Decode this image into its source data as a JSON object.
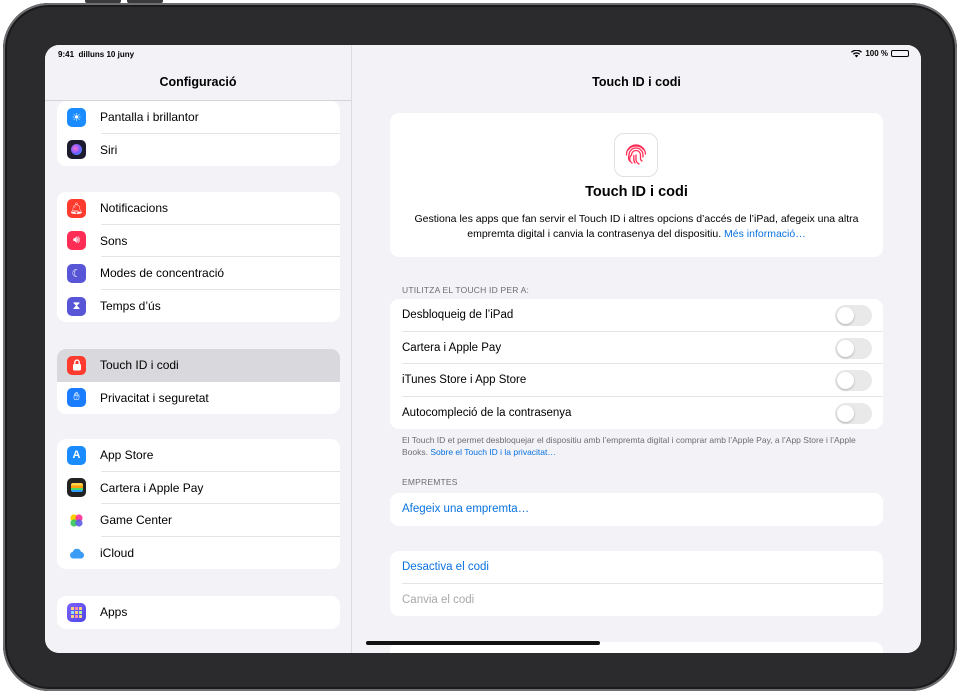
{
  "status_bar": {
    "time": "9:41",
    "date": "dilluns 10 juny",
    "battery": "100 %"
  },
  "sidebar": {
    "title": "Configuració",
    "groups": [
      {
        "items": [
          {
            "label": "Pantalla i brillantor",
            "icon": "sun-icon",
            "color": "#1a8cff"
          },
          {
            "label": "Siri",
            "icon": "siri-icon",
            "color": "#1c1c2e"
          }
        ]
      },
      {
        "items": [
          {
            "label": "Notificacions",
            "icon": "bell-icon",
            "color": "#ff3b30"
          },
          {
            "label": "Sons",
            "icon": "speaker-icon",
            "color": "#ff2d55"
          },
          {
            "label": "Modes de concentració",
            "icon": "moon-icon",
            "color": "#5856d6"
          },
          {
            "label": "Temps d’ús",
            "icon": "hourglass-icon",
            "color": "#5856d6"
          }
        ]
      },
      {
        "items": [
          {
            "label": "Touch ID i codi",
            "icon": "lock-icon",
            "color": "#ff3b30",
            "selected": true
          },
          {
            "label": "Privacitat i seguretat",
            "icon": "hand-icon",
            "color": "#1a7cff"
          }
        ]
      },
      {
        "items": [
          {
            "label": "App Store",
            "icon": "app-store-icon",
            "color": "#1a8cff"
          },
          {
            "label": "Cartera i Apple Pay",
            "icon": "wallet-icon",
            "color": "#222222"
          },
          {
            "label": "Game Center",
            "icon": "game-center-icon",
            "color": "#ffffff"
          },
          {
            "label": "iCloud",
            "icon": "cloud-icon",
            "color": "#ffffff"
          }
        ]
      },
      {
        "items": [
          {
            "label": "Apps",
            "icon": "apps-grid-icon",
            "color": "#5e5ce6"
          }
        ]
      }
    ]
  },
  "detail": {
    "title": "Touch ID i codi",
    "hero": {
      "title": "Touch ID i codi",
      "description": "Gestiona les apps que fan servir el Touch ID i altres opcions d’accés de l’iPad, afegeix una altra empremta digital i canvia la contrasenya del dispositiu.",
      "link": "Més informació…"
    },
    "use_section": {
      "header": "UTILITZA EL TOUCH ID PER A:",
      "toggles": [
        {
          "label": "Desbloqueig de l’iPad",
          "on": false
        },
        {
          "label": "Cartera i Apple Pay",
          "on": false
        },
        {
          "label": "iTunes Store i App Store",
          "on": false
        },
        {
          "label": "Autocompleció de la contrasenya",
          "on": false
        }
      ],
      "footer": "El Touch ID et permet desbloquejar el dispositiu amb l’empremta digital i comprar amb l’Apple Pay, a l’App Store i l’Apple Books.",
      "footer_link": "Sobre el Touch ID i la privacitat…"
    },
    "fingerprints": {
      "header": "EMPREMTES",
      "add": "Afegeix una empremta…"
    },
    "passcode": {
      "turn_off": "Desactiva el codi",
      "change": "Canvia el codi"
    }
  }
}
